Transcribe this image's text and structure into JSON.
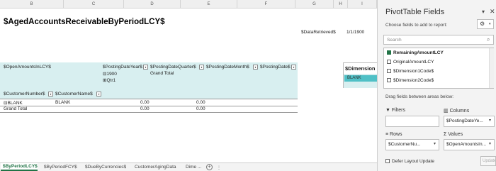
{
  "columns": [
    "B",
    "C",
    "D",
    "E",
    "F",
    "G",
    "H",
    "I"
  ],
  "report": {
    "title": "$AgedAccountsReceivableByPeriodLCY$",
    "data_retrieved_label": "$DataRetrieved$",
    "data_retrieved_value": "1/1/1900"
  },
  "pivot": {
    "values_field": "$OpenAmountsInLCY$",
    "col_fields": [
      "$PostingDateYear$",
      "$PostingDateQuarter$",
      "$PostingDateMonth$",
      "$PostingDate$"
    ],
    "year_item": "1900",
    "quarter_item": "Qtr1",
    "grand_total_col": "Grand Total",
    "row_fields": [
      "$CustomerNumber$",
      "$CustomerName$"
    ],
    "rows": [
      {
        "number": "BLANK",
        "name": "BLANK",
        "v1": "0.00",
        "v2": "0.00"
      }
    ],
    "grand_total_row": {
      "label": "Grand Total",
      "v1": "0.00",
      "v2": "0.00"
    },
    "expand_minus": "⊟",
    "expand_plus": "⊞"
  },
  "dimension": {
    "header": "$Dimension",
    "item": "BLANK"
  },
  "sheet_tabs": [
    "$ByPeriodLCY$",
    "$ByPeriodFCY$",
    "$DueByCurrencies$",
    "CustomerAgingData",
    "Dime ..."
  ],
  "panel": {
    "title": "PivotTable Fields",
    "subtitle": "Choose fields to add to report:",
    "search_placeholder": "Search",
    "fields": [
      {
        "label": "RemainingAmountLCY",
        "checked": true
      },
      {
        "label": "OriginalAmountLCY",
        "checked": false
      },
      {
        "label": "$Dimension1Code$",
        "checked": false
      },
      {
        "label": "$Dimension2Code$",
        "checked": false
      }
    ],
    "drag_label": "Drag fields between areas below:",
    "filters_label": "Filters",
    "columns_label": "Columns",
    "columns_item": "$PostingDateYe...",
    "rows_label": "Rows",
    "rows_item": "$CustomerNu...",
    "values_label": "Values",
    "values_item": "$OpenAmountsIn...",
    "defer_label": "Defer Layout Update",
    "update_label": "Update"
  },
  "colors": {
    "tab_active": "#217346",
    "pivot_band": "#d8eff0",
    "dim_item": "#4fc0c6"
  }
}
